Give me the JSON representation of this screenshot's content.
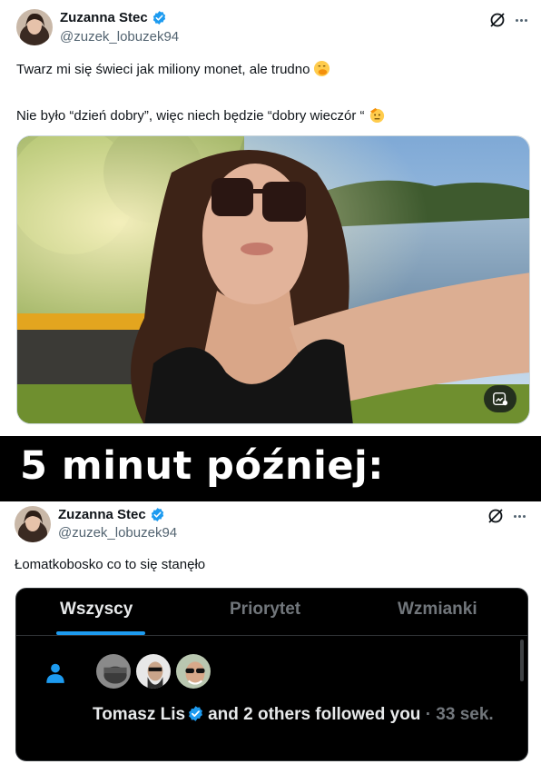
{
  "tweet_top": {
    "display_name": "Zuzanna Stec",
    "handle": "@zuzek_lobuzek94",
    "line1": "Twarz mi się świeci jak miliony monet, ale trudno",
    "line1_emoji": "face-with-hand-over-mouth",
    "line2": "Nie było “dzień dobry”, więc niech będzie “dobry wieczór “",
    "line2_emoji": "saluting-face",
    "media_icon": "edit-image-icon"
  },
  "caption": {
    "text": "5 minut później:"
  },
  "tweet_bottom": {
    "display_name": "Zuzanna Stec",
    "handle": "@zuzek_lobuzek94",
    "text": "Łomatkobosko co to się stanęło"
  },
  "notifications": {
    "tabs": [
      {
        "label": "Wszyscy",
        "active": true
      },
      {
        "label": "Priorytet",
        "active": false
      },
      {
        "label": "Wzmianki",
        "active": false
      }
    ],
    "item": {
      "icon": "person-icon",
      "user": "Tomasz Lis",
      "rest": "and 2 others followed you",
      "time": "· 33 sek."
    }
  },
  "colors": {
    "verified_blue": "#1d9bf0",
    "text_primary": "#0f1419",
    "text_secondary": "#536471",
    "dark_bg": "#000000"
  }
}
